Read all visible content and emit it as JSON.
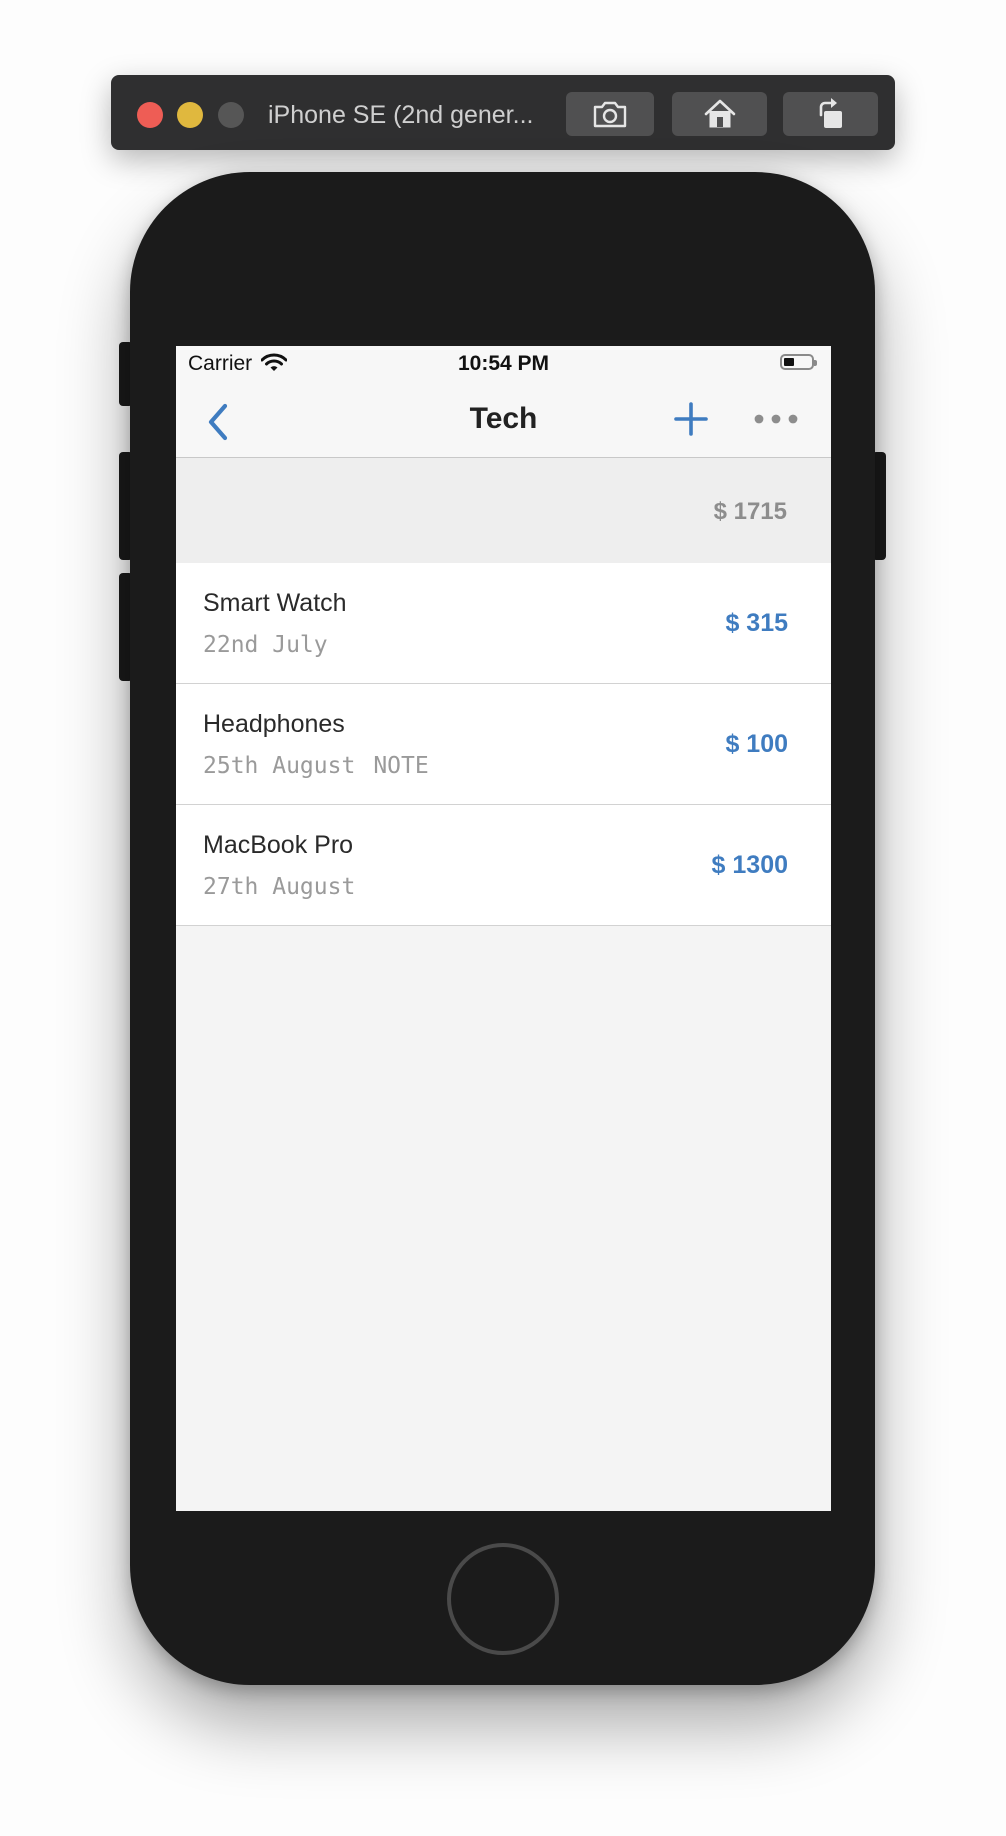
{
  "simulator": {
    "device_title": "iPhone SE (2nd gener...",
    "buttons": [
      "screenshot-icon",
      "home-icon",
      "rotate-icon"
    ]
  },
  "status_bar": {
    "carrier": "Carrier",
    "time": "10:54 PM"
  },
  "nav": {
    "title": "Tech",
    "back_icon": "chevron-left-icon",
    "add_icon": "plus-icon",
    "more_icon": "ellipsis-icon"
  },
  "total": {
    "amount": "$ 1715"
  },
  "items": [
    {
      "name": "Smart Watch",
      "date": "22nd July",
      "note": "",
      "amount": "$ 315"
    },
    {
      "name": "Headphones",
      "date": "25th August",
      "note": "NOTE",
      "amount": "$ 100"
    },
    {
      "name": "MacBook Pro",
      "date": "27th August",
      "note": "",
      "amount": "$ 1300"
    }
  ],
  "colors": {
    "accent": "#3f7cc0",
    "device_body": "#1b1b1b",
    "screen_bg": "#f4f4f4"
  }
}
